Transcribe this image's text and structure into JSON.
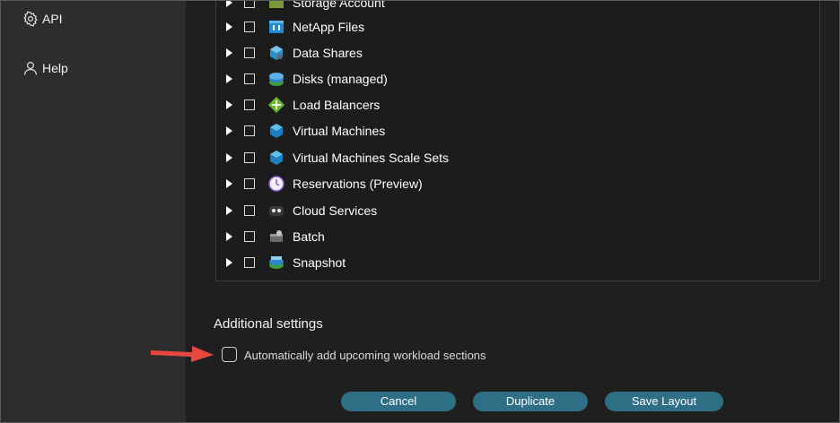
{
  "sidebar": {
    "items": [
      {
        "label": "API",
        "icon": "gear-icon"
      },
      {
        "label": "Help",
        "icon": "person-icon"
      }
    ]
  },
  "tree": {
    "items": [
      {
        "label": "Storage Account",
        "icon": "storage-account-icon"
      },
      {
        "label": "NetApp Files",
        "icon": "netapp-files-icon"
      },
      {
        "label": "Data Shares",
        "icon": "data-shares-icon"
      },
      {
        "label": "Disks (managed)",
        "icon": "disks-icon"
      },
      {
        "label": "Load Balancers",
        "icon": "load-balancer-icon"
      },
      {
        "label": "Virtual Machines",
        "icon": "virtual-machine-icon"
      },
      {
        "label": "Virtual Machines Scale Sets",
        "icon": "vm-scale-set-icon"
      },
      {
        "label": "Reservations (Preview)",
        "icon": "clock-icon"
      },
      {
        "label": "Cloud Services",
        "icon": "cloud-services-icon"
      },
      {
        "label": "Batch",
        "icon": "batch-icon"
      },
      {
        "label": "Snapshot",
        "icon": "snapshot-icon"
      }
    ]
  },
  "additional_settings": {
    "title": "Additional settings",
    "option_label": "Automatically add upcoming workload sections",
    "option_checked": false
  },
  "buttons": {
    "cancel": "Cancel",
    "duplicate": "Duplicate",
    "save_layout": "Save Layout"
  },
  "colors": {
    "button_bg": "#2f6f86",
    "arrow": "#e8473f"
  }
}
